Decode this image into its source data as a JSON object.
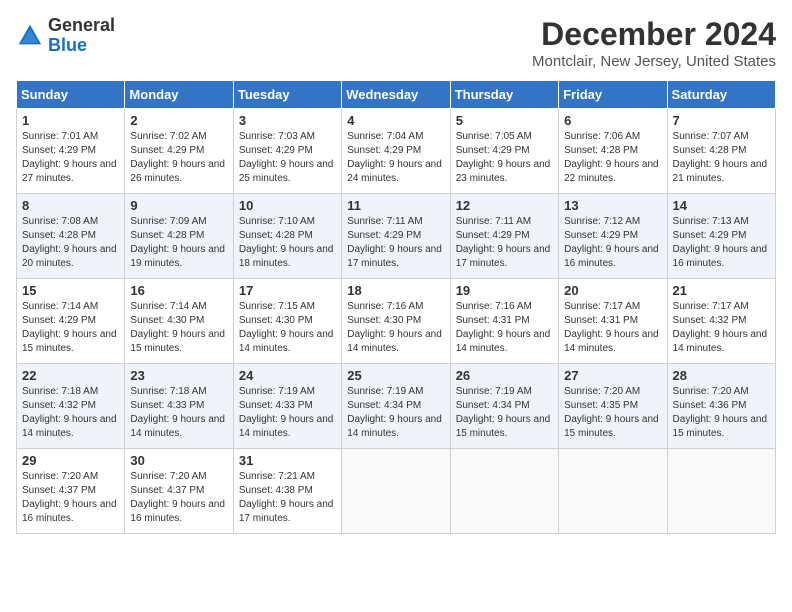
{
  "header": {
    "logo_general": "General",
    "logo_blue": "Blue",
    "title": "December 2024",
    "subtitle": "Montclair, New Jersey, United States"
  },
  "days_of_week": [
    "Sunday",
    "Monday",
    "Tuesday",
    "Wednesday",
    "Thursday",
    "Friday",
    "Saturday"
  ],
  "weeks": [
    [
      {
        "day": "1",
        "sunrise": "7:01 AM",
        "sunset": "4:29 PM",
        "daylight": "9 hours and 27 minutes."
      },
      {
        "day": "2",
        "sunrise": "7:02 AM",
        "sunset": "4:29 PM",
        "daylight": "9 hours and 26 minutes."
      },
      {
        "day": "3",
        "sunrise": "7:03 AM",
        "sunset": "4:29 PM",
        "daylight": "9 hours and 25 minutes."
      },
      {
        "day": "4",
        "sunrise": "7:04 AM",
        "sunset": "4:29 PM",
        "daylight": "9 hours and 24 minutes."
      },
      {
        "day": "5",
        "sunrise": "7:05 AM",
        "sunset": "4:29 PM",
        "daylight": "9 hours and 23 minutes."
      },
      {
        "day": "6",
        "sunrise": "7:06 AM",
        "sunset": "4:28 PM",
        "daylight": "9 hours and 22 minutes."
      },
      {
        "day": "7",
        "sunrise": "7:07 AM",
        "sunset": "4:28 PM",
        "daylight": "9 hours and 21 minutes."
      }
    ],
    [
      {
        "day": "8",
        "sunrise": "7:08 AM",
        "sunset": "4:28 PM",
        "daylight": "9 hours and 20 minutes."
      },
      {
        "day": "9",
        "sunrise": "7:09 AM",
        "sunset": "4:28 PM",
        "daylight": "9 hours and 19 minutes."
      },
      {
        "day": "10",
        "sunrise": "7:10 AM",
        "sunset": "4:28 PM",
        "daylight": "9 hours and 18 minutes."
      },
      {
        "day": "11",
        "sunrise": "7:11 AM",
        "sunset": "4:29 PM",
        "daylight": "9 hours and 17 minutes."
      },
      {
        "day": "12",
        "sunrise": "7:11 AM",
        "sunset": "4:29 PM",
        "daylight": "9 hours and 17 minutes."
      },
      {
        "day": "13",
        "sunrise": "7:12 AM",
        "sunset": "4:29 PM",
        "daylight": "9 hours and 16 minutes."
      },
      {
        "day": "14",
        "sunrise": "7:13 AM",
        "sunset": "4:29 PM",
        "daylight": "9 hours and 16 minutes."
      }
    ],
    [
      {
        "day": "15",
        "sunrise": "7:14 AM",
        "sunset": "4:29 PM",
        "daylight": "9 hours and 15 minutes."
      },
      {
        "day": "16",
        "sunrise": "7:14 AM",
        "sunset": "4:30 PM",
        "daylight": "9 hours and 15 minutes."
      },
      {
        "day": "17",
        "sunrise": "7:15 AM",
        "sunset": "4:30 PM",
        "daylight": "9 hours and 14 minutes."
      },
      {
        "day": "18",
        "sunrise": "7:16 AM",
        "sunset": "4:30 PM",
        "daylight": "9 hours and 14 minutes."
      },
      {
        "day": "19",
        "sunrise": "7:16 AM",
        "sunset": "4:31 PM",
        "daylight": "9 hours and 14 minutes."
      },
      {
        "day": "20",
        "sunrise": "7:17 AM",
        "sunset": "4:31 PM",
        "daylight": "9 hours and 14 minutes."
      },
      {
        "day": "21",
        "sunrise": "7:17 AM",
        "sunset": "4:32 PM",
        "daylight": "9 hours and 14 minutes."
      }
    ],
    [
      {
        "day": "22",
        "sunrise": "7:18 AM",
        "sunset": "4:32 PM",
        "daylight": "9 hours and 14 minutes."
      },
      {
        "day": "23",
        "sunrise": "7:18 AM",
        "sunset": "4:33 PM",
        "daylight": "9 hours and 14 minutes."
      },
      {
        "day": "24",
        "sunrise": "7:19 AM",
        "sunset": "4:33 PM",
        "daylight": "9 hours and 14 minutes."
      },
      {
        "day": "25",
        "sunrise": "7:19 AM",
        "sunset": "4:34 PM",
        "daylight": "9 hours and 14 minutes."
      },
      {
        "day": "26",
        "sunrise": "7:19 AM",
        "sunset": "4:34 PM",
        "daylight": "9 hours and 15 minutes."
      },
      {
        "day": "27",
        "sunrise": "7:20 AM",
        "sunset": "4:35 PM",
        "daylight": "9 hours and 15 minutes."
      },
      {
        "day": "28",
        "sunrise": "7:20 AM",
        "sunset": "4:36 PM",
        "daylight": "9 hours and 15 minutes."
      }
    ],
    [
      {
        "day": "29",
        "sunrise": "7:20 AM",
        "sunset": "4:37 PM",
        "daylight": "9 hours and 16 minutes."
      },
      {
        "day": "30",
        "sunrise": "7:20 AM",
        "sunset": "4:37 PM",
        "daylight": "9 hours and 16 minutes."
      },
      {
        "day": "31",
        "sunrise": "7:21 AM",
        "sunset": "4:38 PM",
        "daylight": "9 hours and 17 minutes."
      },
      null,
      null,
      null,
      null
    ]
  ],
  "labels": {
    "sunrise": "Sunrise: ",
    "sunset": "Sunset: ",
    "daylight": "Daylight: "
  }
}
